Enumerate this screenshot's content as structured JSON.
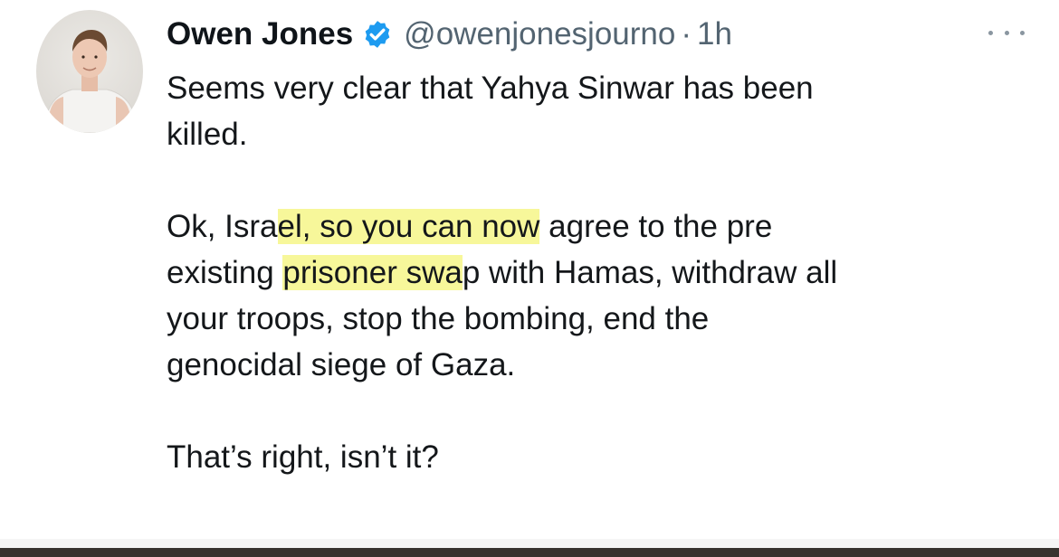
{
  "tweet": {
    "author_name": "Owen Jones",
    "handle": "@owenjonesjourno",
    "separator": "·",
    "time": "1h",
    "body": {
      "para1_line1": "Seems very clear that Yahya Sinwar has been",
      "para1_line2": "killed.",
      "para2_line1_a": "Ok, Isra",
      "para2_line1_hl": "el, so you can now",
      "para2_line1_b": " agree to the pre",
      "para2_line2_a": "existing ",
      "para2_line2_hl": "prisoner swa",
      "para2_line2_b": "p with Hamas, withdraw all",
      "para2_line3": "your troops, stop the bombing, end the",
      "para2_line4": "genocidal siege of Gaza.",
      "para3": "That’s right, isn’t it?"
    },
    "icons": {
      "verified": "verified-badge-icon",
      "more": "more-options-icon",
      "avatar": "profile-photo"
    },
    "colors": {
      "verified_blue": "#1d9bf0",
      "highlight": "#f7f79a",
      "secondary_text": "#536471"
    }
  }
}
